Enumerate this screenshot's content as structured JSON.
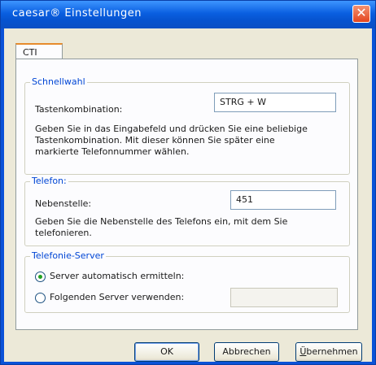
{
  "window": {
    "title": "caesar® Einstellungen"
  },
  "tabs": [
    {
      "label": "CTI"
    }
  ],
  "schnellwahl": {
    "title": "Schnellwahl",
    "shortcut_label": "Tastenkombination:",
    "shortcut_value": "STRG + W",
    "description_line1": "Geben Sie in das Eingabefeld und drücken Sie eine beliebige",
    "description_line2": "Tastenkombination. Mit dieser können Sie später eine",
    "description_line3": "markierte Telefonnummer wählen."
  },
  "telefon": {
    "title": "Telefon:",
    "extension_label": "Nebenstelle:",
    "extension_value": "451",
    "description_line1": "Geben Sie die Nebenstelle des Telefons ein, mit dem Sie",
    "description_line2": "telefonieren."
  },
  "server": {
    "title": "Telefonie-Server",
    "option_auto_label": "Server automatisch ermitteln:",
    "option_manual_label": "Folgenden Server verwenden:",
    "selected": "auto",
    "server_value": ""
  },
  "buttons": {
    "ok": "OK",
    "cancel": "Abbrechen",
    "apply_accel": "Ü",
    "apply_rest": "bernehmen"
  },
  "colors": {
    "titlebar": "#0a5fe0",
    "group_title": "#0046d5",
    "close": "#e5451e"
  }
}
